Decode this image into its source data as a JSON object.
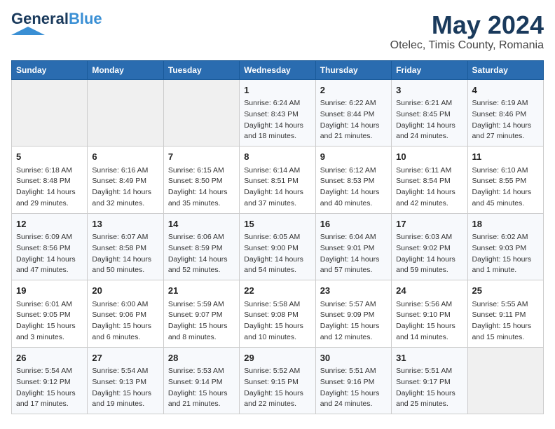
{
  "logo": {
    "line1a": "General",
    "line1b": "Blue",
    "tagline": ""
  },
  "header": {
    "month_year": "May 2024",
    "location": "Otelec, Timis County, Romania"
  },
  "days_of_week": [
    "Sunday",
    "Monday",
    "Tuesday",
    "Wednesday",
    "Thursday",
    "Friday",
    "Saturday"
  ],
  "weeks": [
    [
      {
        "day": "",
        "info": ""
      },
      {
        "day": "",
        "info": ""
      },
      {
        "day": "",
        "info": ""
      },
      {
        "day": "1",
        "info": "Sunrise: 6:24 AM\nSunset: 8:43 PM\nDaylight: 14 hours\nand 18 minutes."
      },
      {
        "day": "2",
        "info": "Sunrise: 6:22 AM\nSunset: 8:44 PM\nDaylight: 14 hours\nand 21 minutes."
      },
      {
        "day": "3",
        "info": "Sunrise: 6:21 AM\nSunset: 8:45 PM\nDaylight: 14 hours\nand 24 minutes."
      },
      {
        "day": "4",
        "info": "Sunrise: 6:19 AM\nSunset: 8:46 PM\nDaylight: 14 hours\nand 27 minutes."
      }
    ],
    [
      {
        "day": "5",
        "info": "Sunrise: 6:18 AM\nSunset: 8:48 PM\nDaylight: 14 hours\nand 29 minutes."
      },
      {
        "day": "6",
        "info": "Sunrise: 6:16 AM\nSunset: 8:49 PM\nDaylight: 14 hours\nand 32 minutes."
      },
      {
        "day": "7",
        "info": "Sunrise: 6:15 AM\nSunset: 8:50 PM\nDaylight: 14 hours\nand 35 minutes."
      },
      {
        "day": "8",
        "info": "Sunrise: 6:14 AM\nSunset: 8:51 PM\nDaylight: 14 hours\nand 37 minutes."
      },
      {
        "day": "9",
        "info": "Sunrise: 6:12 AM\nSunset: 8:53 PM\nDaylight: 14 hours\nand 40 minutes."
      },
      {
        "day": "10",
        "info": "Sunrise: 6:11 AM\nSunset: 8:54 PM\nDaylight: 14 hours\nand 42 minutes."
      },
      {
        "day": "11",
        "info": "Sunrise: 6:10 AM\nSunset: 8:55 PM\nDaylight: 14 hours\nand 45 minutes."
      }
    ],
    [
      {
        "day": "12",
        "info": "Sunrise: 6:09 AM\nSunset: 8:56 PM\nDaylight: 14 hours\nand 47 minutes."
      },
      {
        "day": "13",
        "info": "Sunrise: 6:07 AM\nSunset: 8:58 PM\nDaylight: 14 hours\nand 50 minutes."
      },
      {
        "day": "14",
        "info": "Sunrise: 6:06 AM\nSunset: 8:59 PM\nDaylight: 14 hours\nand 52 minutes."
      },
      {
        "day": "15",
        "info": "Sunrise: 6:05 AM\nSunset: 9:00 PM\nDaylight: 14 hours\nand 54 minutes."
      },
      {
        "day": "16",
        "info": "Sunrise: 6:04 AM\nSunset: 9:01 PM\nDaylight: 14 hours\nand 57 minutes."
      },
      {
        "day": "17",
        "info": "Sunrise: 6:03 AM\nSunset: 9:02 PM\nDaylight: 14 hours\nand 59 minutes."
      },
      {
        "day": "18",
        "info": "Sunrise: 6:02 AM\nSunset: 9:03 PM\nDaylight: 15 hours\nand 1 minute."
      }
    ],
    [
      {
        "day": "19",
        "info": "Sunrise: 6:01 AM\nSunset: 9:05 PM\nDaylight: 15 hours\nand 3 minutes."
      },
      {
        "day": "20",
        "info": "Sunrise: 6:00 AM\nSunset: 9:06 PM\nDaylight: 15 hours\nand 6 minutes."
      },
      {
        "day": "21",
        "info": "Sunrise: 5:59 AM\nSunset: 9:07 PM\nDaylight: 15 hours\nand 8 minutes."
      },
      {
        "day": "22",
        "info": "Sunrise: 5:58 AM\nSunset: 9:08 PM\nDaylight: 15 hours\nand 10 minutes."
      },
      {
        "day": "23",
        "info": "Sunrise: 5:57 AM\nSunset: 9:09 PM\nDaylight: 15 hours\nand 12 minutes."
      },
      {
        "day": "24",
        "info": "Sunrise: 5:56 AM\nSunset: 9:10 PM\nDaylight: 15 hours\nand 14 minutes."
      },
      {
        "day": "25",
        "info": "Sunrise: 5:55 AM\nSunset: 9:11 PM\nDaylight: 15 hours\nand 15 minutes."
      }
    ],
    [
      {
        "day": "26",
        "info": "Sunrise: 5:54 AM\nSunset: 9:12 PM\nDaylight: 15 hours\nand 17 minutes."
      },
      {
        "day": "27",
        "info": "Sunrise: 5:54 AM\nSunset: 9:13 PM\nDaylight: 15 hours\nand 19 minutes."
      },
      {
        "day": "28",
        "info": "Sunrise: 5:53 AM\nSunset: 9:14 PM\nDaylight: 15 hours\nand 21 minutes."
      },
      {
        "day": "29",
        "info": "Sunrise: 5:52 AM\nSunset: 9:15 PM\nDaylight: 15 hours\nand 22 minutes."
      },
      {
        "day": "30",
        "info": "Sunrise: 5:51 AM\nSunset: 9:16 PM\nDaylight: 15 hours\nand 24 minutes."
      },
      {
        "day": "31",
        "info": "Sunrise: 5:51 AM\nSunset: 9:17 PM\nDaylight: 15 hours\nand 25 minutes."
      },
      {
        "day": "",
        "info": ""
      }
    ]
  ]
}
